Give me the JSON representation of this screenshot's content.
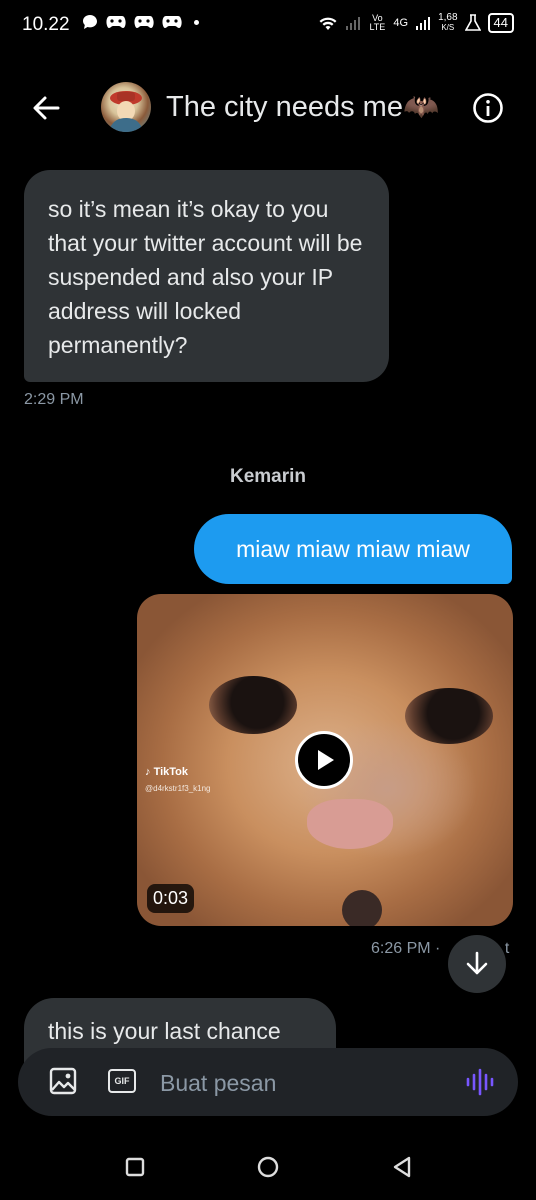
{
  "status_bar": {
    "time": "10.22",
    "network_label": "Vo LTE",
    "network_type": "4G",
    "speed_value": "1,68",
    "speed_unit": "K/S",
    "battery": "44"
  },
  "header": {
    "title": "The city needs me🦇",
    "back_icon": "arrow-left-icon",
    "info_icon": "info-icon"
  },
  "messages": {
    "incoming_1": {
      "text": "so it’s mean it’s okay to you that your twitter account will be suspended and also your IP address will locked permanently?",
      "time": "2:29 PM"
    },
    "day_separator": "Kemarin",
    "outgoing_1": {
      "text": "miaw miaw miaw miaw"
    },
    "outgoing_video": {
      "watermark": "TikTok",
      "watermark_user": "@d4rkstr1f3_k1ng",
      "duration": "0:03",
      "time": "6:26 PM · ",
      "status_fragment": "t"
    },
    "incoming_2": {
      "text_partial": "this is your last chance"
    }
  },
  "compose": {
    "placeholder": "Buat pesan",
    "gif_label": "GIF",
    "accent_color": "#7856ff"
  },
  "colors": {
    "background": "#000000",
    "incoming_bubble": "#2f3336",
    "outgoing_bubble": "#1d9bf0",
    "secondary_text": "#8b98a5"
  }
}
